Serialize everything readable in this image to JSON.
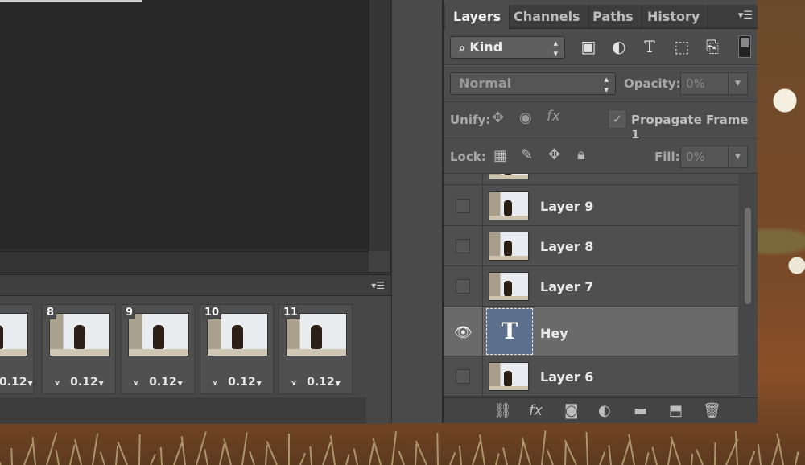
{
  "timeline": {
    "frames": [
      {
        "num": "",
        "delay": "0.12"
      },
      {
        "num": "8",
        "delay": "0.12"
      },
      {
        "num": "9",
        "delay": "0.12"
      },
      {
        "num": "10",
        "delay": "0.12"
      },
      {
        "num": "11",
        "delay": "0.12"
      }
    ]
  },
  "layers_panel": {
    "tabs": [
      "Layers",
      "Channels",
      "Paths",
      "History"
    ],
    "filter": {
      "kind_label": "Kind"
    },
    "blend": {
      "mode": "Normal",
      "opacity_label": "Opacity:",
      "opacity_value": "0%"
    },
    "unify": {
      "label": "Unify:",
      "propagate_label": "Propagate Frame 1"
    },
    "lock": {
      "label": "Lock:",
      "fill_label": "Fill:",
      "fill_value": "0%"
    },
    "layers": [
      {
        "name": "Layer 9",
        "visible": false,
        "type": "image"
      },
      {
        "name": "Layer 8",
        "visible": false,
        "type": "image"
      },
      {
        "name": "Layer 7",
        "visible": false,
        "type": "image"
      },
      {
        "name": "Hey",
        "visible": true,
        "type": "text",
        "selected": true
      },
      {
        "name": "Layer 6",
        "visible": false,
        "type": "image"
      }
    ]
  }
}
